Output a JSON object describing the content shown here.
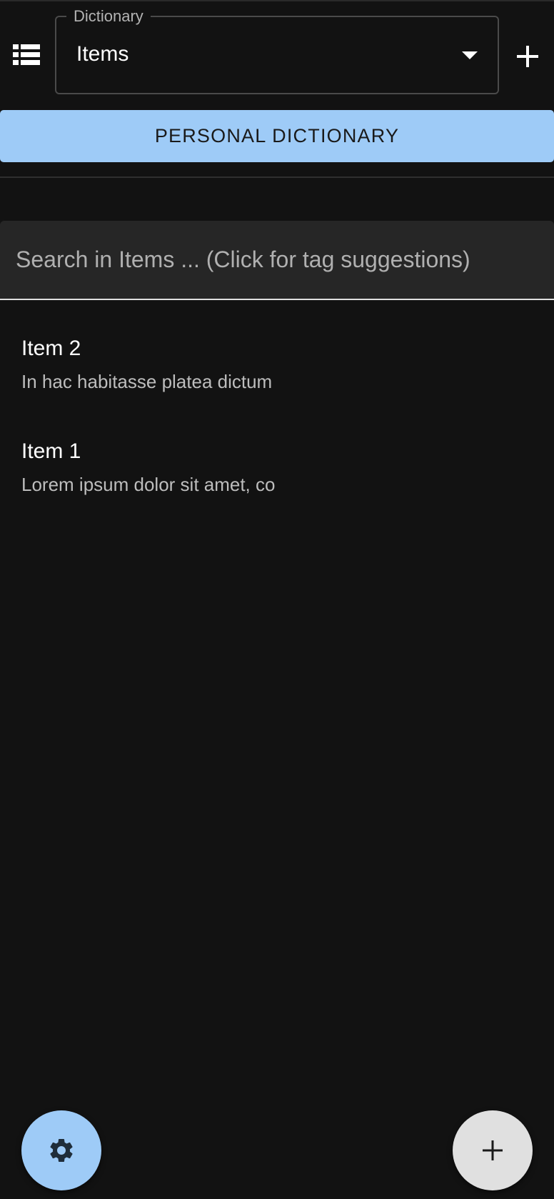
{
  "header": {
    "menu_icon": "view-list-icon",
    "dictionary_label": "Dictionary",
    "dictionary_value": "Items",
    "dropdown_icon": "caret-down-icon",
    "add_icon": "plus-icon"
  },
  "personal_dictionary_button": {
    "label": "PERSONAL DICTIONARY",
    "color": "#9ecbf7"
  },
  "search": {
    "placeholder": "Search in Items ... (Click for tag suggestions)",
    "value": ""
  },
  "items": [
    {
      "title": "Item 2",
      "description": "In hac habitasse platea dictum"
    },
    {
      "title": "Item 1",
      "description": "Lorem ipsum dolor sit amet, co"
    }
  ],
  "fabs": {
    "settings_icon": "gear-icon",
    "settings_color": "#9ecbf7",
    "add_icon": "plus-icon",
    "add_color": "#e0e0e0"
  },
  "theme": {
    "background": "#121212",
    "accent": "#9ecbf7"
  }
}
